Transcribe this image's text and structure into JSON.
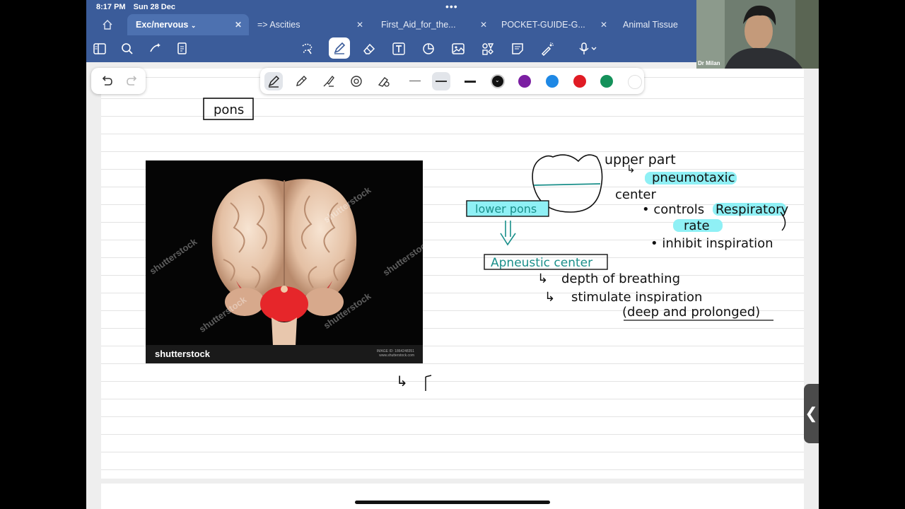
{
  "status": {
    "time": "8:17 PM",
    "date": "Sun 28 Dec"
  },
  "tabs": [
    {
      "label": "Exc/nervous",
      "active": true
    },
    {
      "label": "=> Ascities"
    },
    {
      "label": "First_Aid_for_the..."
    },
    {
      "label": "POCKET-GUIDE-G..."
    },
    {
      "label": "Animal Tissue"
    }
  ],
  "toolbar_icons": [
    "sidebar-icon",
    "search-icon",
    "magic-icon",
    "pages-icon",
    "lasso-icon",
    "pen-icon",
    "eraser-icon",
    "textbox-icon",
    "shapes-icon",
    "image-icon",
    "elements-icon",
    "sticky-note-icon",
    "laser-pointer-icon",
    "microphone-icon"
  ],
  "pen_colors": [
    "#111111",
    "#7b1fa2",
    "#1e88e5",
    "#e01b24",
    "#14915a",
    "#ffffff"
  ],
  "photo": {
    "logo": "shutterstock",
    "watermark": "shutterstock",
    "image_id_line1": "IMAGE ID: 1864248351",
    "image_id_line2": "www.shutterstock.com"
  },
  "video": {
    "name": "Dr Milan"
  },
  "notes": {
    "title": "pons",
    "upper_part": "upper part",
    "pneumotaxic": "pneumotaxic",
    "center": "center",
    "controls": "controls",
    "respiratory": "Respiratory",
    "rate": "rate",
    "inhibit": "inhibit inspiration",
    "lower_pons": "lower pons",
    "apneustic": "Apneustic center",
    "depth": "depth of breathing",
    "stimulate": "stimulate inspiration",
    "deep": "(deep and prolonged)"
  },
  "colors": {
    "topbar": "#3b5c9a",
    "highlight": "#7fe3ef",
    "teal_ink": "#1a8f8a"
  }
}
